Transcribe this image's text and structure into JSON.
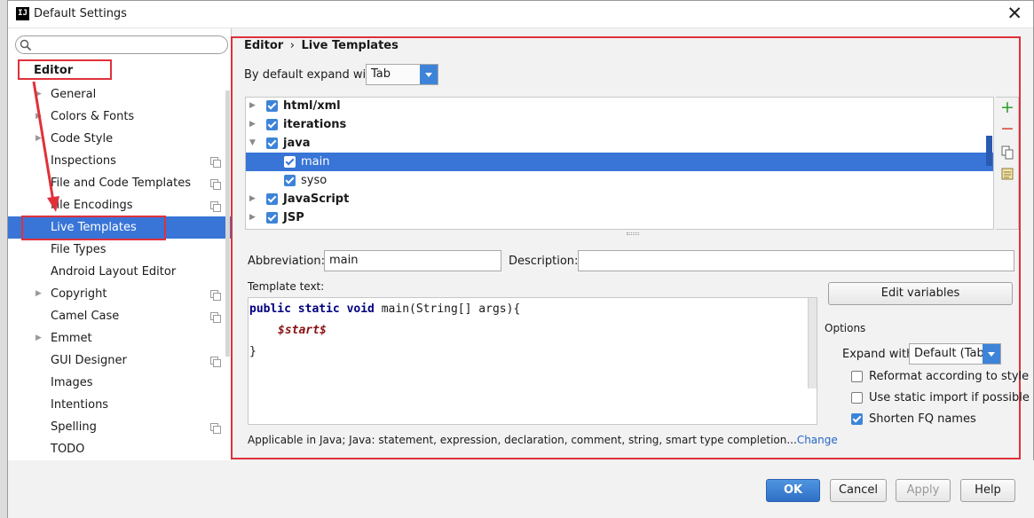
{
  "window": {
    "title": "Default Settings",
    "app_icon": "IJ"
  },
  "sidebar": {
    "section": "Editor",
    "items": [
      {
        "label": "General",
        "arrow": true,
        "copy": false
      },
      {
        "label": "Colors & Fonts",
        "arrow": true,
        "copy": false
      },
      {
        "label": "Code Style",
        "arrow": true,
        "copy": false
      },
      {
        "label": "Inspections",
        "arrow": false,
        "copy": true
      },
      {
        "label": "File and Code Templates",
        "arrow": false,
        "copy": true
      },
      {
        "label": "File Encodings",
        "arrow": false,
        "copy": true
      },
      {
        "label": "Live Templates",
        "arrow": false,
        "copy": false,
        "selected": true
      },
      {
        "label": "File Types",
        "arrow": false,
        "copy": false
      },
      {
        "label": "Android Layout Editor",
        "arrow": false,
        "copy": false
      },
      {
        "label": "Copyright",
        "arrow": true,
        "copy": true
      },
      {
        "label": "Camel Case",
        "arrow": false,
        "copy": true
      },
      {
        "label": "Emmet",
        "arrow": true,
        "copy": false
      },
      {
        "label": "GUI Designer",
        "arrow": false,
        "copy": true
      },
      {
        "label": "Images",
        "arrow": false,
        "copy": false
      },
      {
        "label": "Intentions",
        "arrow": false,
        "copy": false
      },
      {
        "label": "Spelling",
        "arrow": false,
        "copy": true
      },
      {
        "label": "TODO",
        "arrow": false,
        "copy": false
      }
    ]
  },
  "breadcrumb": {
    "parent": "Editor",
    "separator": "›",
    "current": "Live Templates"
  },
  "expand": {
    "label": "By default expand with",
    "value": "Tab"
  },
  "templates": [
    {
      "label": "html/xml",
      "group": true,
      "expanded": false,
      "checked": true
    },
    {
      "label": "iterations",
      "group": true,
      "expanded": false,
      "checked": true
    },
    {
      "label": "java",
      "group": true,
      "expanded": true,
      "checked": true
    },
    {
      "label": "main",
      "group": false,
      "checked": true,
      "selected": true
    },
    {
      "label": "syso",
      "group": false,
      "checked": true
    },
    {
      "label": "JavaScript",
      "group": true,
      "expanded": false,
      "checked": true
    },
    {
      "label": "JSP",
      "group": true,
      "expanded": false,
      "checked": true
    }
  ],
  "tools": {
    "add": "+",
    "remove": "−"
  },
  "form": {
    "abbreviation_label": "Abbreviation:",
    "abbreviation_value": "main",
    "description_label": "Description:",
    "description_value": "",
    "template_text_label": "Template text:",
    "code_line1_kw": "public static void",
    "code_line1_rest": " main(String[] args){",
    "code_line2": "$start$",
    "code_line3": "}",
    "edit_variables": "Edit variables"
  },
  "options": {
    "title": "Options",
    "expand_with_label": "Expand with",
    "expand_with_value": "Default (Tab)",
    "reformat": {
      "label": "Reformat according to style",
      "checked": false
    },
    "static_import": {
      "label": "Use static import if possible",
      "checked": false
    },
    "shorten_fq": {
      "label": "Shorten FQ names",
      "checked": true
    }
  },
  "applicable": {
    "text": "Applicable in Java; Java: statement, expression, declaration, comment, string, smart type completion...",
    "link": "Change"
  },
  "buttons": {
    "ok": "OK",
    "cancel": "Cancel",
    "apply": "Apply",
    "help": "Help"
  },
  "colors": {
    "selection": "#3875d7",
    "accent": "#3d84d8",
    "highlight_box": "#e0313a"
  }
}
